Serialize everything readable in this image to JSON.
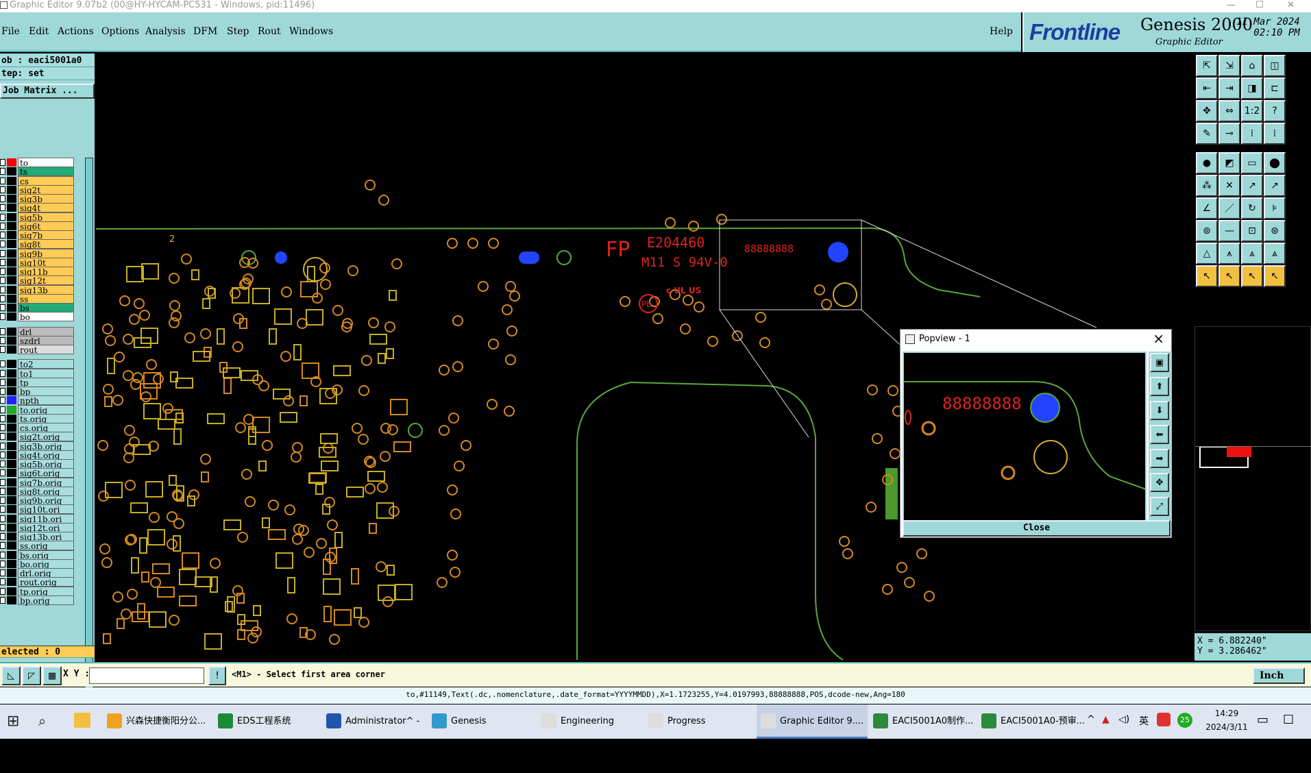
{
  "window": {
    "title": "Graphic Editor 9.07b2 (00@HY-HYCAM-PC531 - Windows, pid:11496)",
    "min": "—",
    "max": "☐",
    "close": "✕"
  },
  "menu": {
    "items": [
      "File",
      "Edit",
      "Actions",
      "Options",
      "Analysis",
      "DFM",
      "Step",
      "Rout",
      "Windows"
    ],
    "help": "Help"
  },
  "brand": {
    "logo": "Frontline",
    "product": "Genesis 2000",
    "subtitle": "Graphic Editor",
    "date": "11 Mar 2024",
    "time": "02:10 PM"
  },
  "job": {
    "job": "ob : eaci5001a0",
    "step": "tep: set",
    "matrix_button": "Job Matrix ..."
  },
  "layers": [
    {
      "name": "to",
      "bg": "#ffffff",
      "sw": "#ff0000"
    },
    {
      "name": "ts",
      "bg": "#22aa77",
      "sw": "#000000"
    },
    {
      "name": "cs",
      "bg": "#ffcc55",
      "sw": "#000000"
    },
    {
      "name": "sig2t",
      "bg": "#ffcc55",
      "sw": "#000000"
    },
    {
      "name": "sig3b",
      "bg": "#ffcc55",
      "sw": "#000000"
    },
    {
      "name": "sig4t",
      "bg": "#ffcc55",
      "sw": "#000000"
    },
    {
      "name": "sig5b",
      "bg": "#ffcc55",
      "sw": "#000000"
    },
    {
      "name": "sig6t",
      "bg": "#ffcc55",
      "sw": "#000000"
    },
    {
      "name": "sig7b",
      "bg": "#ffcc55",
      "sw": "#000000"
    },
    {
      "name": "sig8t",
      "bg": "#ffcc55",
      "sw": "#000000"
    },
    {
      "name": "sig9b",
      "bg": "#ffcc55",
      "sw": "#000000"
    },
    {
      "name": "sig10t",
      "bg": "#ffcc55",
      "sw": "#000000"
    },
    {
      "name": "sig11b",
      "bg": "#ffcc55",
      "sw": "#000000"
    },
    {
      "name": "sig12t",
      "bg": "#ffcc55",
      "sw": "#000000"
    },
    {
      "name": "sig13b",
      "bg": "#ffcc55",
      "sw": "#000000"
    },
    {
      "name": "ss",
      "bg": "#ffcc55",
      "sw": "#000000"
    },
    {
      "name": "bs",
      "bg": "#22aa77",
      "sw": "#000000"
    },
    {
      "name": "bo",
      "bg": "#ffffff",
      "sw": "#000000"
    },
    {
      "name": "drl",
      "bg": "#bbbbbb",
      "sw": "#000000"
    },
    {
      "name": "szdrl",
      "bg": "#bbbbbb",
      "sw": "#000000"
    },
    {
      "name": "rout",
      "bg": "#dddddd",
      "sw": "#000000"
    },
    {
      "name": "to2",
      "bg": "#a8dede",
      "sw": "#000000"
    },
    {
      "name": "to1",
      "bg": "#a8dede",
      "sw": "#000000"
    },
    {
      "name": "tp",
      "bg": "#a8dede",
      "sw": "#000000"
    },
    {
      "name": "bp",
      "bg": "#a8dede",
      "sw": "#000000"
    },
    {
      "name": "npth",
      "bg": "#a8dede",
      "sw": "#2222ff"
    },
    {
      "name": "to.orig",
      "bg": "#a8dede",
      "sw": "#22aa22"
    },
    {
      "name": "ts.orig",
      "bg": "#a8dede",
      "sw": "#000000"
    },
    {
      "name": "cs.orig",
      "bg": "#a8dede",
      "sw": "#000000"
    },
    {
      "name": "sig2t.orig",
      "bg": "#a8dede",
      "sw": "#000000"
    },
    {
      "name": "sig3b.orig",
      "bg": "#a8dede",
      "sw": "#000000"
    },
    {
      "name": "sig4t.orig",
      "bg": "#a8dede",
      "sw": "#000000"
    },
    {
      "name": "sig5b.orig",
      "bg": "#a8dede",
      "sw": "#000000"
    },
    {
      "name": "sig6t.orig",
      "bg": "#a8dede",
      "sw": "#000000"
    },
    {
      "name": "sig7b.orig",
      "bg": "#a8dede",
      "sw": "#000000"
    },
    {
      "name": "sig8t.orig",
      "bg": "#a8dede",
      "sw": "#000000"
    },
    {
      "name": "sig9b.orig",
      "bg": "#a8dede",
      "sw": "#000000"
    },
    {
      "name": "sig10t.ori",
      "bg": "#a8dede",
      "sw": "#000000"
    },
    {
      "name": "sig11b.ori",
      "bg": "#a8dede",
      "sw": "#000000"
    },
    {
      "name": "sig12t.ori",
      "bg": "#a8dede",
      "sw": "#000000"
    },
    {
      "name": "sig13b.ori",
      "bg": "#a8dede",
      "sw": "#000000"
    },
    {
      "name": "ss.orig",
      "bg": "#a8dede",
      "sw": "#000000"
    },
    {
      "name": "bs.orig",
      "bg": "#a8dede",
      "sw": "#000000"
    },
    {
      "name": "bo.orig",
      "bg": "#a8dede",
      "sw": "#000000"
    },
    {
      "name": "drl.orig",
      "bg": "#a8dede",
      "sw": "#000000"
    },
    {
      "name": "rout.orig",
      "bg": "#a8dede",
      "sw": "#000000"
    },
    {
      "name": "tp.orig",
      "bg": "#a8dede",
      "sw": "#000000"
    },
    {
      "name": "bp.orig",
      "bg": "#a8dede",
      "sw": "#000000"
    }
  ],
  "selected": "elected : 0",
  "canvas_text": {
    "fp": "FP",
    "cert": "E204460",
    "material": "M11 S 94V-0",
    "ul": "c UL US",
    "pb": "Pb",
    "serial": "88888888",
    "num": "2"
  },
  "popview": {
    "title": "Popview - 1",
    "close_label": "Close",
    "serial": "88888888"
  },
  "coords": {
    "x": "X = 6.882240\"",
    "y": "Y = 3.286462\""
  },
  "cmd": {
    "xy_label": "X Y :",
    "prompt": "<M1> - Select first area corner",
    "unit": "Inch"
  },
  "status": "to,#11149,Text(.dc,.nomenclature,.date_format=YYYYMMDD),X=1.1723255,Y=4.0197993,88888888,POS,dcode-new,Ang=180",
  "taskbar": {
    "items": [
      "兴森快捷衡阳分公...",
      "EDS工程系统",
      "Administrator^ - ...",
      "Genesis",
      "Engineering Tool...",
      "Progress",
      "Graphic Editor 9....",
      "EACI5001A0制作...",
      "EACI5001A0-预审..."
    ],
    "time": "14:29",
    "date": "2024/3/11",
    "ime": "英",
    "badge": "25"
  }
}
